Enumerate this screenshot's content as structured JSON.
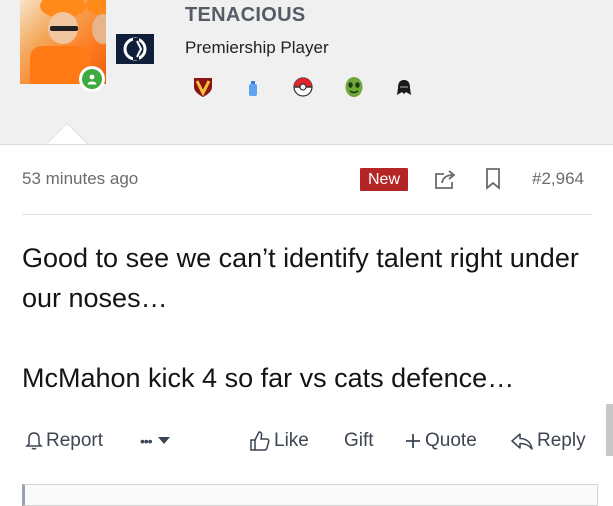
{
  "user": {
    "name": "TENACIOUS",
    "title": "Premiership Player",
    "badges": [
      "shield-v-badge",
      "bottle-badge",
      "pokeball-badge",
      "alien-badge",
      "darth-vader-badge"
    ],
    "online_color": "#3dab3f"
  },
  "post": {
    "time": "53 minutes ago",
    "new_label": "New",
    "number": "#2,964",
    "lines": [
      "Good to see we can’t identify talent right under our noses…",
      "McMahon kick 4 so far vs cats defence…"
    ]
  },
  "actions": {
    "report": "Report",
    "more": "•••",
    "like": "Like",
    "gift": "Gift",
    "quote": "Quote",
    "reply": "Reply"
  },
  "colors": {
    "accent_new": "#b42525",
    "header_bg": "#f0f0f0",
    "muted_text": "#6b6b6b"
  }
}
